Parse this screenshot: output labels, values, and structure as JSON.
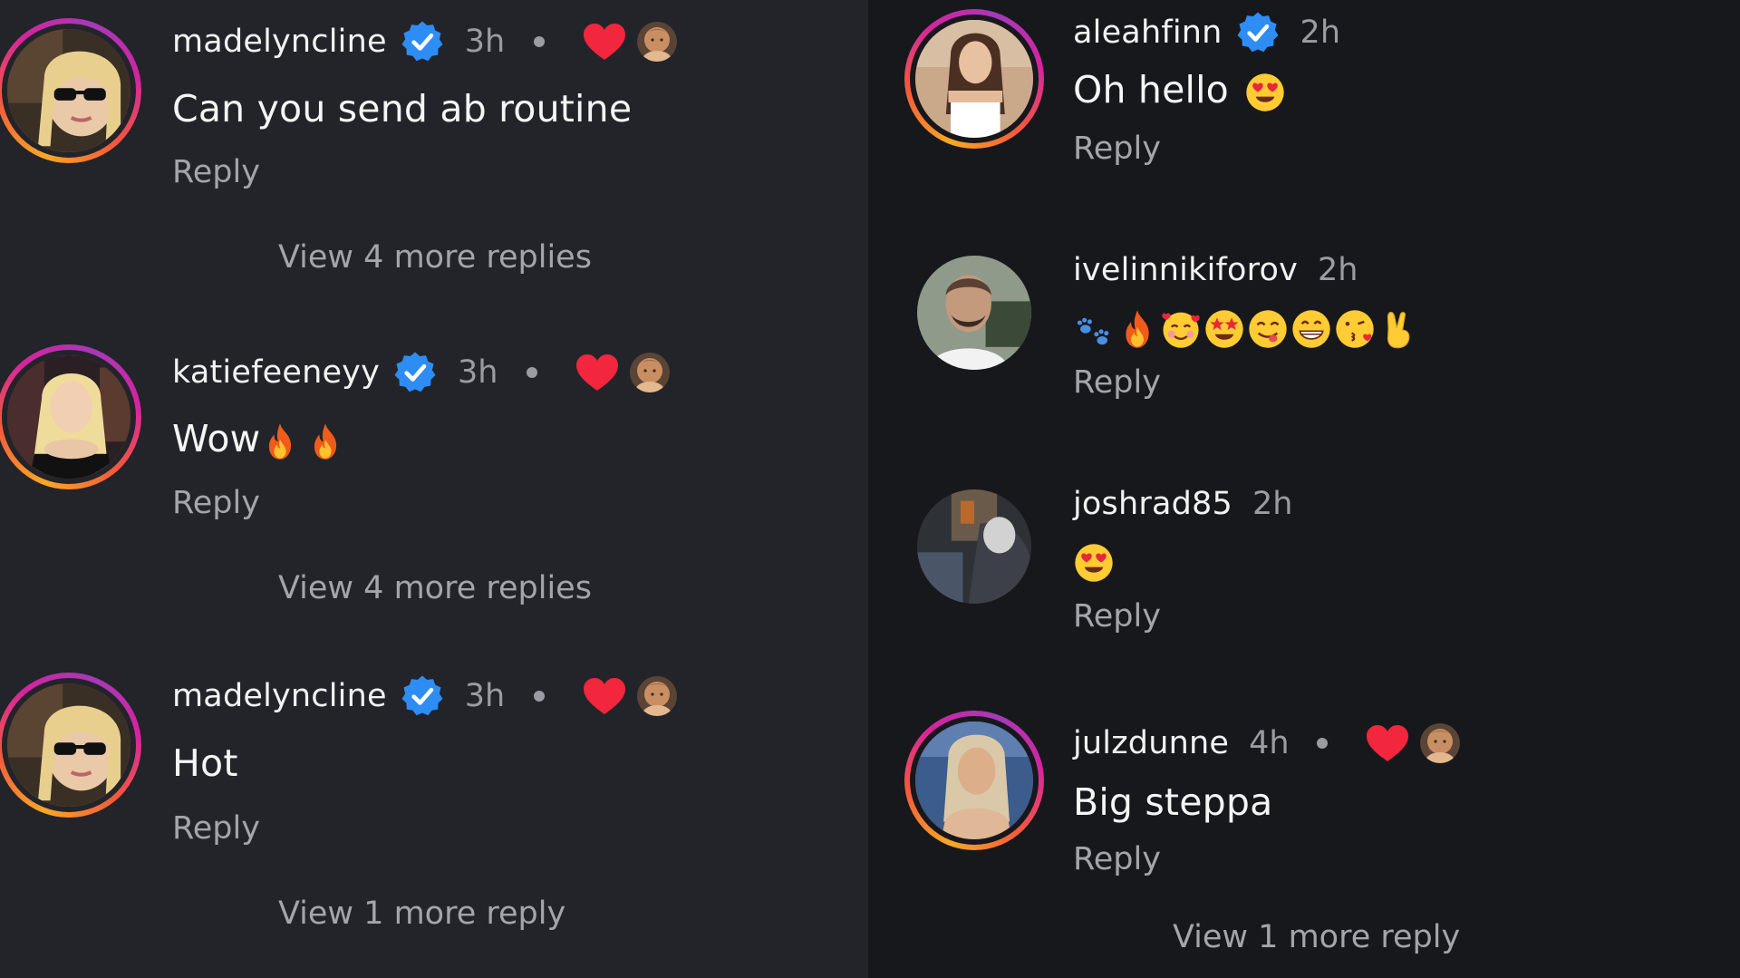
{
  "left_column": {
    "comments": [
      {
        "username": "madelyncline",
        "verified": true,
        "time": "3h",
        "text": "Can you send ab routine",
        "liked_by_author": true,
        "reply_label": "Reply",
        "view_more": "View 4 more replies"
      },
      {
        "username": "katiefeeneyy",
        "verified": true,
        "time": "3h",
        "text": "Wow",
        "emojis": [
          "fire-emoji",
          "fire-emoji"
        ],
        "liked_by_author": true,
        "reply_label": "Reply",
        "view_more": "View 4 more replies"
      },
      {
        "username": "madelyncline",
        "verified": true,
        "time": "3h",
        "text": "Hot",
        "liked_by_author": true,
        "reply_label": "Reply",
        "view_more": "View 1 more reply"
      }
    ]
  },
  "right_column": {
    "comments": [
      {
        "username": "aleahfinn",
        "verified": true,
        "time": "2h",
        "text": "Oh hello",
        "emojis": [
          "heart-eyes-emoji"
        ],
        "reply_label": "Reply"
      },
      {
        "username": "ivelinnikiforov",
        "verified": false,
        "time": "2h",
        "text": "",
        "emojis": [
          "paw-prints-emoji",
          "fire-emoji",
          "smiling-face-with-hearts-emoji",
          "star-struck-emoji",
          "yum-emoji",
          "grin-emoji",
          "kissing-heart-emoji",
          "victory-hand-emoji"
        ],
        "reply_label": "Reply"
      },
      {
        "username": "joshrad85",
        "verified": false,
        "time": "2h",
        "text": "",
        "emojis": [
          "heart-eyes-emoji"
        ],
        "reply_label": "Reply"
      },
      {
        "username": "julzdunne",
        "verified": false,
        "time": "4h",
        "text": "Big steppa",
        "liked_by_author": true,
        "reply_label": "Reply",
        "view_more": "View 1 more reply"
      }
    ]
  },
  "colors": {
    "background_left": "#222429",
    "background_right": "#17181c",
    "heart": "#f2263c",
    "verified": "#2e8df5",
    "secondary_text": "#a3a5ab"
  }
}
